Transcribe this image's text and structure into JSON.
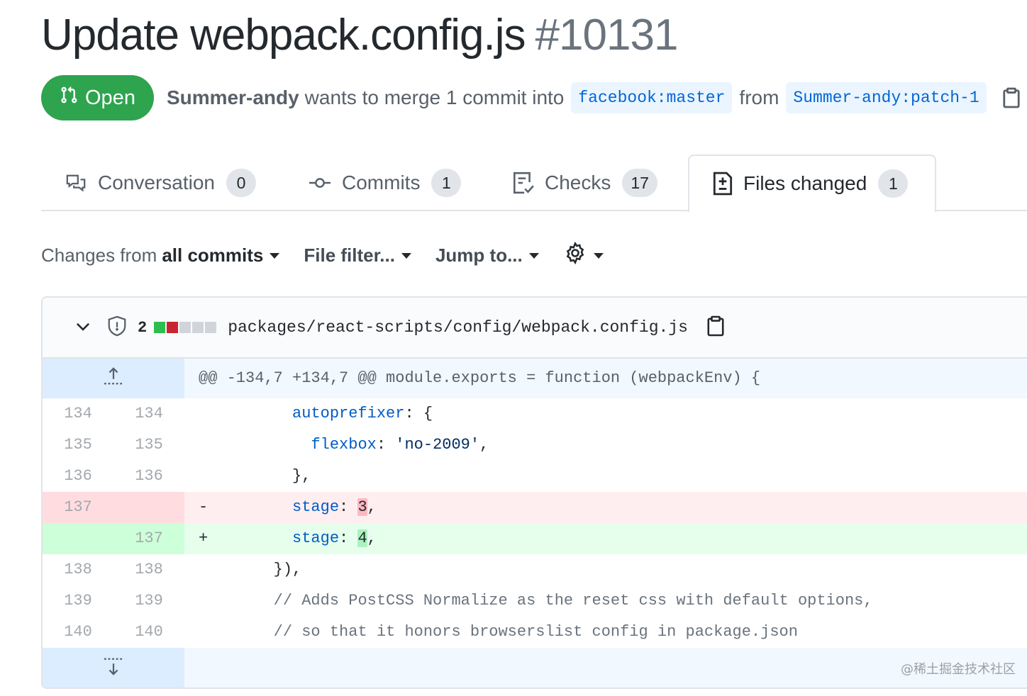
{
  "pr": {
    "title": "Update webpack.config.js",
    "number": "#10131",
    "state": "Open",
    "author": "Summer-andy",
    "merge_text": "wants to merge 1 commit into",
    "base_branch": "facebook:master",
    "from_text": "from",
    "head_branch": "Summer-andy:patch-1"
  },
  "tabs": [
    {
      "label": "Conversation",
      "count": "0",
      "icon": "comment-discussion-icon"
    },
    {
      "label": "Commits",
      "count": "1",
      "icon": "git-commit-icon"
    },
    {
      "label": "Checks",
      "count": "17",
      "icon": "checklist-icon"
    },
    {
      "label": "Files changed",
      "count": "1",
      "icon": "file-diff-icon",
      "selected": true
    }
  ],
  "toolbar": {
    "changes_prefix": "Changes from",
    "changes_value": "all commits",
    "file_filter": "File filter...",
    "jump_to": "Jump to..."
  },
  "file": {
    "change_count": "2",
    "path": "packages/react-scripts/config/webpack.config.js",
    "diffstat": [
      "add",
      "del",
      "neutral",
      "neutral",
      "neutral"
    ],
    "colors": {
      "add": "#2cbe4e",
      "del": "#cb2431",
      "neutral": "#d1d5da"
    }
  },
  "diff": {
    "hunk_header": "@@ -134,7 +134,7 @@ module.exports = function (webpackEnv) {",
    "lines": [
      {
        "old": "134",
        "new": "134",
        "sign": "",
        "type": "ctx"
      },
      {
        "old": "135",
        "new": "135",
        "sign": "",
        "type": "ctx"
      },
      {
        "old": "136",
        "new": "136",
        "sign": "",
        "type": "ctx"
      },
      {
        "old": "137",
        "new": "",
        "sign": "-",
        "type": "del"
      },
      {
        "old": "",
        "new": "137",
        "sign": "+",
        "type": "add"
      },
      {
        "old": "138",
        "new": "138",
        "sign": "",
        "type": "ctx"
      },
      {
        "old": "139",
        "new": "139",
        "sign": "",
        "type": "ctx"
      },
      {
        "old": "140",
        "new": "140",
        "sign": "",
        "type": "ctx"
      }
    ],
    "code": {
      "l0_key": "autoprefixer",
      "l0_rest": ": {",
      "l1_key": "flexbox",
      "l1_colon": ": ",
      "l1_str": "'no-2009'",
      "l1_rest": ",",
      "l2": "},",
      "l3_key": "stage",
      "l3_colon": ": ",
      "l3_val": "3",
      "l3_rest": ",",
      "l4_key": "stage",
      "l4_colon": ": ",
      "l4_val": "4",
      "l4_rest": ",",
      "l5": "}),",
      "l6": "// Adds PostCSS Normalize as the reset css with default options,",
      "l7": "// so that it honors browserslist config in package.json"
    }
  },
  "watermark": "@稀土掘金技术社区"
}
